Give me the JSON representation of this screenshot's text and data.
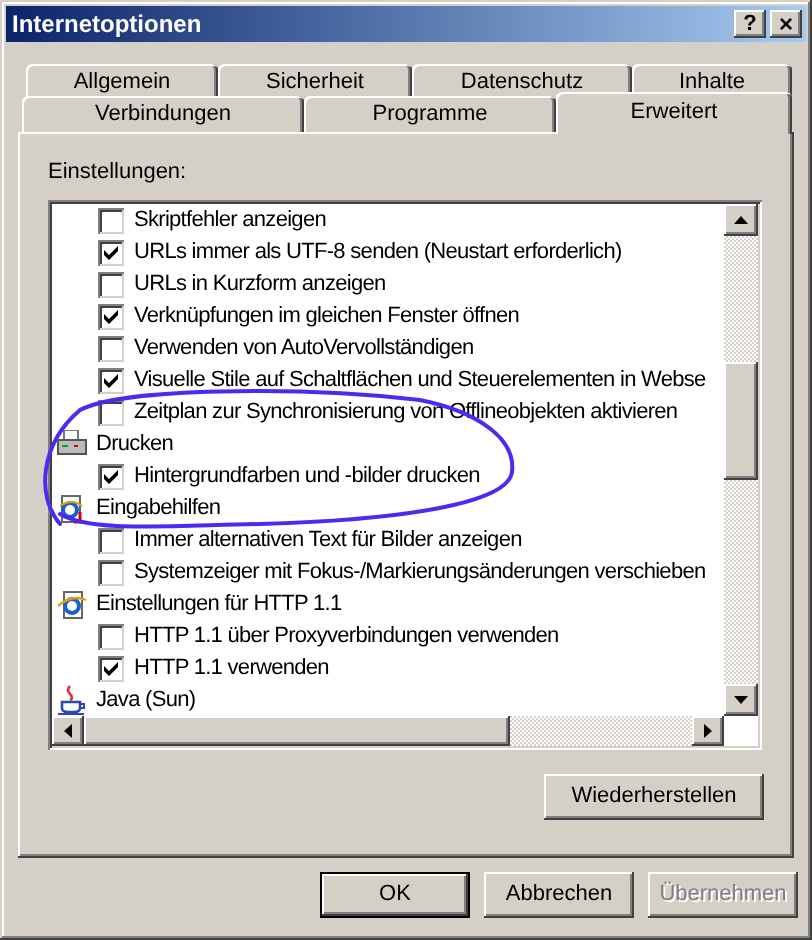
{
  "window": {
    "title": "Internetoptionen",
    "help_button": "?",
    "close_button": "×"
  },
  "tab_rows": [
    [
      {
        "label": "Allgemein",
        "selected": false
      },
      {
        "label": "Sicherheit",
        "selected": false
      },
      {
        "label": "Datenschutz",
        "selected": false
      },
      {
        "label": "Inhalte",
        "selected": false
      }
    ],
    [
      {
        "label": "Verbindungen",
        "selected": false
      },
      {
        "label": "Programme",
        "selected": false
      },
      {
        "label": "Erweitert",
        "selected": true
      }
    ]
  ],
  "settings_label": "Einstellungen:",
  "settings": [
    {
      "kind": "option",
      "label": "Skriptfehler anzeigen",
      "checked": false
    },
    {
      "kind": "option",
      "label": "URLs immer als UTF-8 senden (Neustart erforderlich)",
      "checked": true
    },
    {
      "kind": "option",
      "label": "URLs in Kurzform anzeigen",
      "checked": false
    },
    {
      "kind": "option",
      "label": "Verknüpfungen im gleichen Fenster öffnen",
      "checked": true
    },
    {
      "kind": "option",
      "label": "Verwenden von AutoVervollständigen",
      "checked": false
    },
    {
      "kind": "option",
      "label": "Visuelle Stile auf Schaltflächen und Steuerelementen in Webse",
      "checked": true
    },
    {
      "kind": "option",
      "label": "Zeitplan zur Synchronisierung von Offlineobjekten aktivieren",
      "checked": false
    },
    {
      "kind": "category",
      "label": "Drucken"
    },
    {
      "kind": "option",
      "label": "Hintergrundfarben und -bilder drucken",
      "checked": true
    },
    {
      "kind": "category",
      "label": "Eingabehilfen"
    },
    {
      "kind": "option",
      "label": "Immer alternativen Text für Bilder anzeigen",
      "checked": false
    },
    {
      "kind": "option",
      "label": "Systemzeiger mit Fokus-/Markierungsänderungen verschieben",
      "checked": false
    },
    {
      "kind": "category",
      "label": "Einstellungen für HTTP 1.1"
    },
    {
      "kind": "option",
      "label": "HTTP 1.1 über Proxyverbindungen verwenden",
      "checked": false
    },
    {
      "kind": "option",
      "label": "HTTP 1.1 verwenden",
      "checked": true
    },
    {
      "kind": "category",
      "label": "Java (Sun)"
    }
  ],
  "restore_button": "Wiederherstellen",
  "buttons": [
    {
      "label": "OK",
      "default": true,
      "disabled": false
    },
    {
      "label": "Abbrechen",
      "default": false,
      "disabled": false
    },
    {
      "label": "Übernehmen",
      "default": false,
      "disabled": true
    }
  ]
}
